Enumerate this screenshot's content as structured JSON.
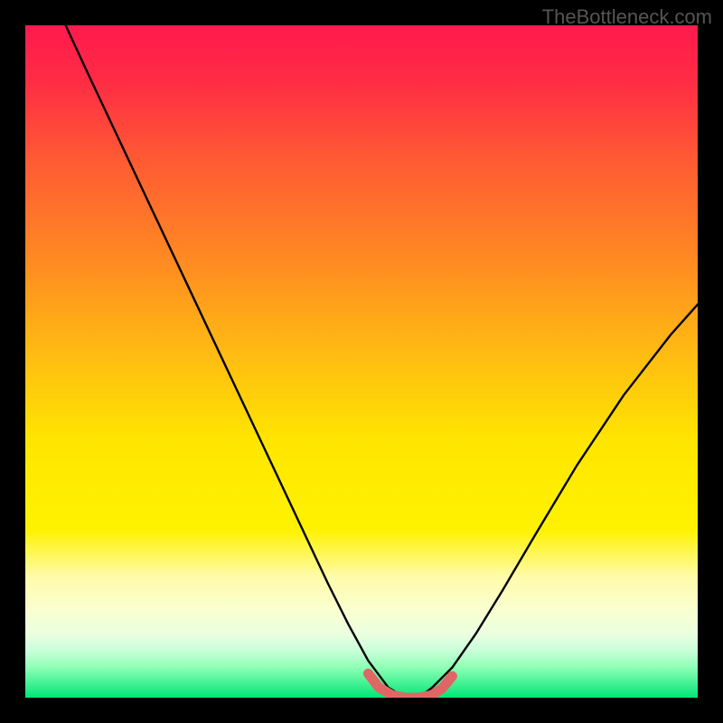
{
  "watermark": "TheBottleneck.com",
  "chart_data": {
    "type": "line",
    "title": "",
    "xlabel": "",
    "ylabel": "",
    "xlim": [
      0,
      1
    ],
    "ylim": [
      0,
      1
    ],
    "background_gradient": {
      "stops": [
        {
          "offset": 0.0,
          "color": "#ff1a4d"
        },
        {
          "offset": 0.08,
          "color": "#ff2b45"
        },
        {
          "offset": 0.2,
          "color": "#ff5a33"
        },
        {
          "offset": 0.35,
          "color": "#ff8a22"
        },
        {
          "offset": 0.5,
          "color": "#ffbf11"
        },
        {
          "offset": 0.62,
          "color": "#ffe600"
        },
        {
          "offset": 0.75,
          "color": "#fff200"
        },
        {
          "offset": 0.82,
          "color": "#fffbaa"
        },
        {
          "offset": 0.87,
          "color": "#f9ffd0"
        },
        {
          "offset": 0.905,
          "color": "#eaffdf"
        },
        {
          "offset": 0.93,
          "color": "#c9ffd9"
        },
        {
          "offset": 0.955,
          "color": "#8effb5"
        },
        {
          "offset": 1.0,
          "color": "#00e676"
        }
      ]
    },
    "series": [
      {
        "name": "bottleneck-curve",
        "x": [
          0.06,
          0.09,
          0.13,
          0.17,
          0.21,
          0.25,
          0.29,
          0.33,
          0.37,
          0.41,
          0.45,
          0.48,
          0.51,
          0.54,
          0.565,
          0.585,
          0.605,
          0.635,
          0.67,
          0.71,
          0.76,
          0.82,
          0.89,
          0.96,
          1.0
        ],
        "y": [
          1.0,
          0.935,
          0.85,
          0.765,
          0.68,
          0.595,
          0.51,
          0.425,
          0.34,
          0.255,
          0.17,
          0.11,
          0.055,
          0.015,
          0.0,
          0.0,
          0.015,
          0.045,
          0.095,
          0.16,
          0.245,
          0.345,
          0.45,
          0.54,
          0.585
        ]
      }
    ],
    "plateau_marker": {
      "x": [
        0.51,
        0.525,
        0.545,
        0.565,
        0.585,
        0.605,
        0.62,
        0.635
      ],
      "y": [
        0.036,
        0.016,
        0.004,
        0.0,
        0.0,
        0.004,
        0.014,
        0.032
      ],
      "color": "#e06666"
    }
  }
}
